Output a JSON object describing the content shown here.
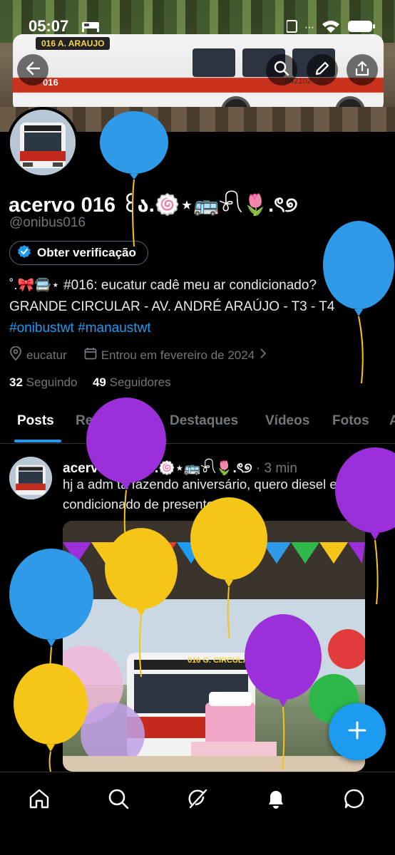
{
  "status_bar": {
    "time": "05:07"
  },
  "profile": {
    "name": "acervo 016 ꒰ა.🍥⋆🚌𓍯🌷.ৎ୭",
    "handle": "@onibus016",
    "verify_label": "Obter verificação",
    "bio_line1": "˚.🎀🚍⋆ #016: eucatur cadê meu ar condicionado?",
    "bio_line2": "GRANDE CIRCULAR - AV. ANDRÉ ARAÚJO - T3 - T4",
    "hashtag1": "#onibustwt",
    "hashtag2": "#manaustwt",
    "location": "eucatur",
    "joined": "Entrou em fevereiro de 2024",
    "following_count": "32",
    "following_label": "Seguindo",
    "followers_count": "49",
    "followers_label": "Seguidores"
  },
  "banner": {
    "bus_sign": "016  A. ARAUJO",
    "bus_number": "016",
    "bus_id": "042102"
  },
  "tabs": [
    {
      "label": "Posts",
      "active": true
    },
    {
      "label": "Respostas",
      "active": false
    },
    {
      "label": "Destaques",
      "active": false
    },
    {
      "label": "Vídeos",
      "active": false
    },
    {
      "label": "Fotos",
      "active": false
    },
    {
      "label": "A",
      "active": false
    }
  ],
  "post": {
    "author": "acervo 016 ꒰ა.🍥⋆🚌𓍯🌷.ৎ୭",
    "time": "· 3 min",
    "text": "hj a adm ta fazendo aniversário, quero diesel e ar condicionado de presente",
    "image_sign": "016  G. CIRCULAR"
  },
  "icons": {
    "back": "arrow-left-icon",
    "search": "search-icon",
    "edit": "pencil-icon",
    "share": "share-icon",
    "location": "location-pin-icon",
    "calendar": "calendar-icon",
    "chevron": "chevron-right-icon",
    "verified": "verified-badge-icon",
    "x_logo": "x-logo-icon",
    "compose": "plus-icon",
    "nav_home": "home-icon",
    "nav_search": "search-icon",
    "nav_grok": "grok-icon",
    "nav_notifications": "bell-icon",
    "nav_messages": "message-icon"
  },
  "colors": {
    "accent": "#1d9bf0",
    "background": "#000000",
    "muted": "#71767b",
    "text": "#e7e9ea",
    "balloon_blue": "#2f9be8",
    "balloon_yellow": "#f5c518",
    "balloon_purple": "#9b2fd9"
  }
}
